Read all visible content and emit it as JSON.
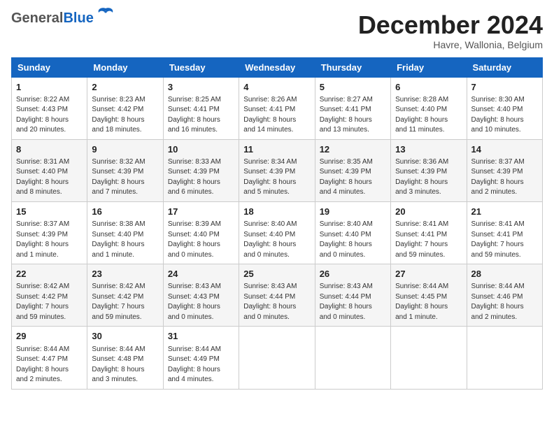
{
  "header": {
    "logo_general": "General",
    "logo_blue": "Blue",
    "month_title": "December 2024",
    "location": "Havre, Wallonia, Belgium"
  },
  "calendar": {
    "weekdays": [
      "Sunday",
      "Monday",
      "Tuesday",
      "Wednesday",
      "Thursday",
      "Friday",
      "Saturday"
    ],
    "weeks": [
      [
        {
          "day": "1",
          "sunrise": "8:22 AM",
          "sunset": "4:43 PM",
          "daylight": "8 hours and 20 minutes."
        },
        {
          "day": "2",
          "sunrise": "8:23 AM",
          "sunset": "4:42 PM",
          "daylight": "8 hours and 18 minutes."
        },
        {
          "day": "3",
          "sunrise": "8:25 AM",
          "sunset": "4:41 PM",
          "daylight": "8 hours and 16 minutes."
        },
        {
          "day": "4",
          "sunrise": "8:26 AM",
          "sunset": "4:41 PM",
          "daylight": "8 hours and 14 minutes."
        },
        {
          "day": "5",
          "sunrise": "8:27 AM",
          "sunset": "4:41 PM",
          "daylight": "8 hours and 13 minutes."
        },
        {
          "day": "6",
          "sunrise": "8:28 AM",
          "sunset": "4:40 PM",
          "daylight": "8 hours and 11 minutes."
        },
        {
          "day": "7",
          "sunrise": "8:30 AM",
          "sunset": "4:40 PM",
          "daylight": "8 hours and 10 minutes."
        }
      ],
      [
        {
          "day": "8",
          "sunrise": "8:31 AM",
          "sunset": "4:40 PM",
          "daylight": "8 hours and 8 minutes."
        },
        {
          "day": "9",
          "sunrise": "8:32 AM",
          "sunset": "4:39 PM",
          "daylight": "8 hours and 7 minutes."
        },
        {
          "day": "10",
          "sunrise": "8:33 AM",
          "sunset": "4:39 PM",
          "daylight": "8 hours and 6 minutes."
        },
        {
          "day": "11",
          "sunrise": "8:34 AM",
          "sunset": "4:39 PM",
          "daylight": "8 hours and 5 minutes."
        },
        {
          "day": "12",
          "sunrise": "8:35 AM",
          "sunset": "4:39 PM",
          "daylight": "8 hours and 4 minutes."
        },
        {
          "day": "13",
          "sunrise": "8:36 AM",
          "sunset": "4:39 PM",
          "daylight": "8 hours and 3 minutes."
        },
        {
          "day": "14",
          "sunrise": "8:37 AM",
          "sunset": "4:39 PM",
          "daylight": "8 hours and 2 minutes."
        }
      ],
      [
        {
          "day": "15",
          "sunrise": "8:37 AM",
          "sunset": "4:39 PM",
          "daylight": "8 hours and 1 minute."
        },
        {
          "day": "16",
          "sunrise": "8:38 AM",
          "sunset": "4:40 PM",
          "daylight": "8 hours and 1 minute."
        },
        {
          "day": "17",
          "sunrise": "8:39 AM",
          "sunset": "4:40 PM",
          "daylight": "8 hours and 0 minutes."
        },
        {
          "day": "18",
          "sunrise": "8:40 AM",
          "sunset": "4:40 PM",
          "daylight": "8 hours and 0 minutes."
        },
        {
          "day": "19",
          "sunrise": "8:40 AM",
          "sunset": "4:40 PM",
          "daylight": "8 hours and 0 minutes."
        },
        {
          "day": "20",
          "sunrise": "8:41 AM",
          "sunset": "4:41 PM",
          "daylight": "7 hours and 59 minutes."
        },
        {
          "day": "21",
          "sunrise": "8:41 AM",
          "sunset": "4:41 PM",
          "daylight": "7 hours and 59 minutes."
        }
      ],
      [
        {
          "day": "22",
          "sunrise": "8:42 AM",
          "sunset": "4:42 PM",
          "daylight": "7 hours and 59 minutes."
        },
        {
          "day": "23",
          "sunrise": "8:42 AM",
          "sunset": "4:42 PM",
          "daylight": "7 hours and 59 minutes."
        },
        {
          "day": "24",
          "sunrise": "8:43 AM",
          "sunset": "4:43 PM",
          "daylight": "8 hours and 0 minutes."
        },
        {
          "day": "25",
          "sunrise": "8:43 AM",
          "sunset": "4:44 PM",
          "daylight": "8 hours and 0 minutes."
        },
        {
          "day": "26",
          "sunrise": "8:43 AM",
          "sunset": "4:44 PM",
          "daylight": "8 hours and 0 minutes."
        },
        {
          "day": "27",
          "sunrise": "8:44 AM",
          "sunset": "4:45 PM",
          "daylight": "8 hours and 1 minute."
        },
        {
          "day": "28",
          "sunrise": "8:44 AM",
          "sunset": "4:46 PM",
          "daylight": "8 hours and 2 minutes."
        }
      ],
      [
        {
          "day": "29",
          "sunrise": "8:44 AM",
          "sunset": "4:47 PM",
          "daylight": "8 hours and 2 minutes."
        },
        {
          "day": "30",
          "sunrise": "8:44 AM",
          "sunset": "4:48 PM",
          "daylight": "8 hours and 3 minutes."
        },
        {
          "day": "31",
          "sunrise": "8:44 AM",
          "sunset": "4:49 PM",
          "daylight": "8 hours and 4 minutes."
        },
        null,
        null,
        null,
        null
      ]
    ]
  }
}
